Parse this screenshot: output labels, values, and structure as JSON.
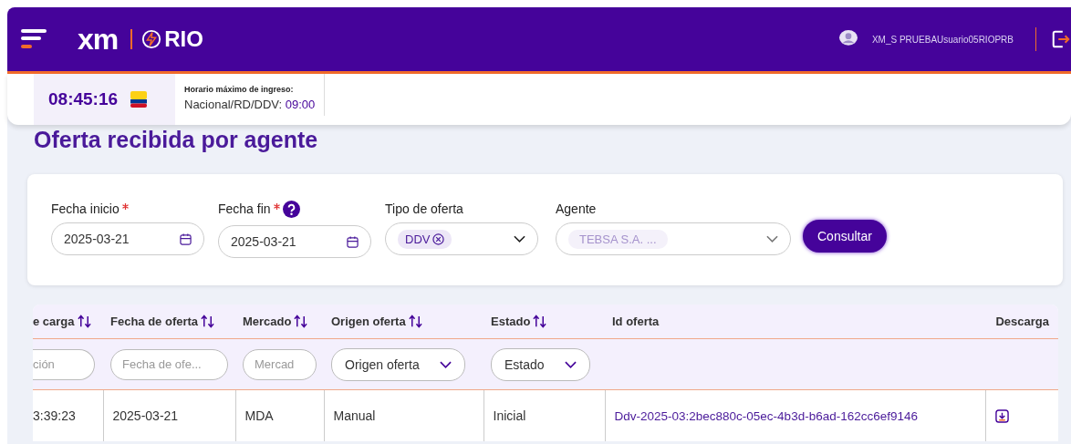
{
  "header": {
    "brand": "xm",
    "app_name": "RIO",
    "user_name": "XM_S PRUEBAUsuario05RIOPRB"
  },
  "info_bar": {
    "clock": "08:45:16",
    "deadline_label": "Horario máximo de ingreso:",
    "deadline_text": "Nacional/RD/DDV:",
    "deadline_time": "09:00"
  },
  "page_title": "Oferta recibida por agente",
  "filters": {
    "fields": [
      {
        "kind": "date",
        "label": "Fecha inicio",
        "required": true,
        "help": false,
        "value": "2025-03-21"
      },
      {
        "kind": "date",
        "label": "Fecha fin",
        "required": true,
        "help": true,
        "value": "2025-03-21"
      },
      {
        "kind": "select",
        "label": "Tipo de oferta",
        "required": false,
        "help": false,
        "disabled": false,
        "chips": [
          {
            "label": "DDV",
            "removable": true
          }
        ]
      },
      {
        "kind": "select",
        "label": "Agente",
        "required": false,
        "help": false,
        "disabled": true,
        "chips": [
          {
            "label": "TEBSA S.A. ...",
            "removable": false
          }
        ]
      }
    ],
    "button": "Consultar"
  },
  "table": {
    "columns": [
      {
        "label": "e carga",
        "sortable": true,
        "kind": "text",
        "filter": {
          "kind": "text",
          "placeholder": "ción"
        }
      },
      {
        "label": "Fecha de oferta",
        "sortable": true,
        "kind": "text",
        "filter": {
          "kind": "text",
          "placeholder": "Fecha de ofe..."
        }
      },
      {
        "label": "Mercado",
        "sortable": true,
        "kind": "text",
        "filter": {
          "kind": "text",
          "placeholder": "Mercad"
        }
      },
      {
        "label": "Origen oferta",
        "sortable": true,
        "kind": "text",
        "filter": {
          "kind": "select",
          "value": "Origen oferta"
        }
      },
      {
        "label": "Estado",
        "sortable": true,
        "kind": "text",
        "filter": {
          "kind": "select",
          "value": "Estado"
        }
      },
      {
        "label": "Id oferta",
        "sortable": false,
        "kind": "link"
      },
      {
        "label": "Descarga",
        "sortable": false,
        "kind": "download"
      }
    ],
    "rows": [
      {
        "cells": [
          "3:39:23",
          "2025-03-21",
          "MDA",
          "Manual",
          "Inicial",
          "Ddv-2025-03:2bec880c-05ec-4b3d-b6ad-162cc6ef9146",
          ""
        ]
      }
    ]
  }
}
